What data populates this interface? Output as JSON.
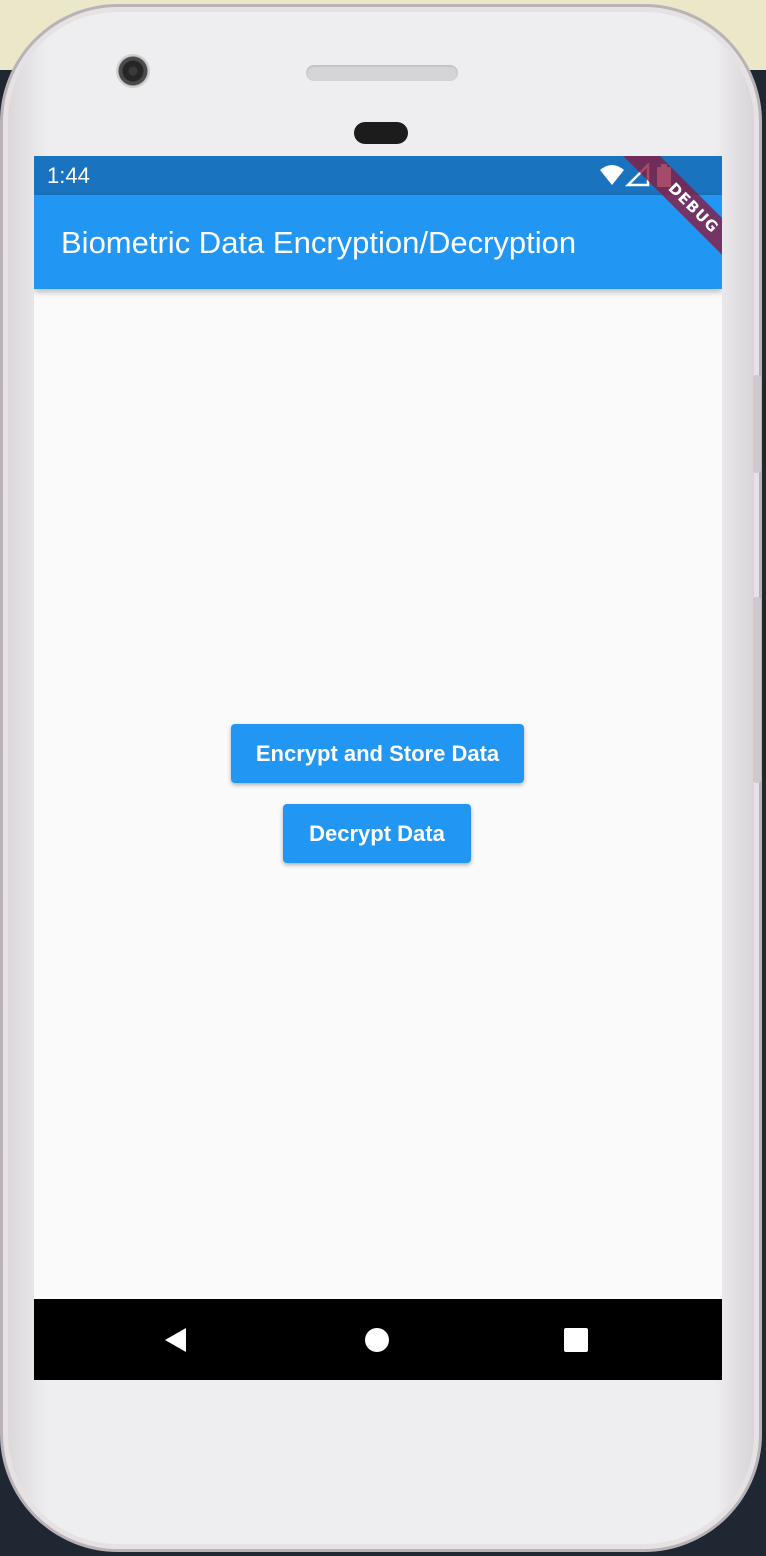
{
  "status_bar": {
    "time": "1:44",
    "icons": [
      "wifi-icon",
      "signal-icon",
      "battery-icon"
    ]
  },
  "app_bar": {
    "title": "Biometric Data Encryption/Decryption",
    "color": "#2196f3"
  },
  "debug_banner": {
    "label": "DEBUG"
  },
  "actions": {
    "encrypt_label": "Encrypt and Store Data",
    "decrypt_label": "Decrypt Data"
  },
  "nav_bar": {
    "icons": [
      "back-icon",
      "home-icon",
      "recents-icon"
    ]
  },
  "colors": {
    "primary": "#2196f3",
    "status_bar": "#1a73be",
    "background": "#fafafa"
  }
}
